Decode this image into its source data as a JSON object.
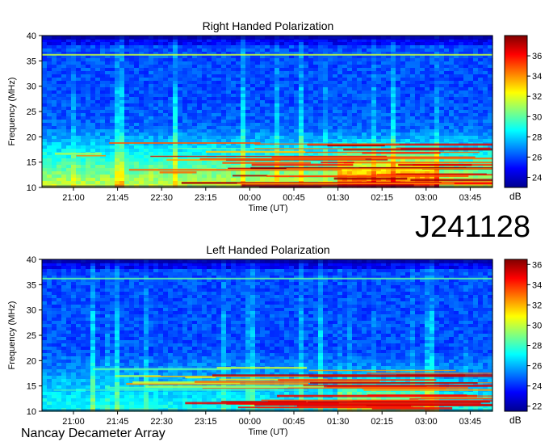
{
  "observation_id": "J241128",
  "instrument": "Nancay Decameter Array",
  "chart_data": [
    {
      "type": "heatmap",
      "title": "Right Handed Polarization",
      "xlabel": "Time (UT)",
      "ylabel": "Frequency (MHz)",
      "x_ticks": [
        "21:00",
        "21:45",
        "22:30",
        "23:15",
        "00:00",
        "00:45",
        "01:30",
        "02:15",
        "03:00",
        "03:45"
      ],
      "y_ticks": [
        10,
        15,
        20,
        25,
        30,
        35,
        40
      ],
      "ylim": [
        10,
        40
      ],
      "colorbar": {
        "label": "dB",
        "range": [
          23,
          38
        ],
        "ticks": [
          24,
          26,
          28,
          30,
          32,
          34,
          36
        ]
      },
      "features": {
        "background_db": 26.0,
        "low_band_db": 30.5,
        "band_edge_line_mhz": 36.2,
        "intense_emission_time_range": [
          "01:30",
          "03:15"
        ],
        "intense_emission_freq_range_mhz": [
          10,
          20
        ]
      }
    },
    {
      "type": "heatmap",
      "title": "Left Handed Polarization",
      "xlabel": "Time (UT)",
      "ylabel": "Frequency (MHz)",
      "x_ticks": [
        "21:00",
        "21:45",
        "22:30",
        "23:15",
        "00:00",
        "00:45",
        "01:30",
        "02:15",
        "03:00",
        "03:45"
      ],
      "y_ticks": [
        10,
        15,
        20,
        25,
        30,
        35,
        40
      ],
      "ylim": [
        10,
        40
      ],
      "colorbar": {
        "label": "dB",
        "range": [
          21.5,
          36.5
        ],
        "ticks": [
          22,
          24,
          26,
          28,
          30,
          32,
          34,
          36
        ]
      },
      "features": {
        "background_db": 24.5,
        "low_band_db": 27.5,
        "band_edge_line_mhz": 36.2,
        "intense_emission_time_range": [
          "01:30",
          "03:15"
        ],
        "intense_emission_freq_range_mhz": [
          10,
          19
        ]
      }
    }
  ]
}
